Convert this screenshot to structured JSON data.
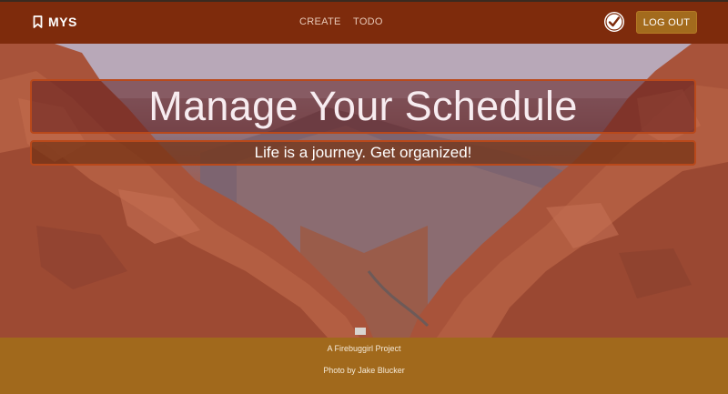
{
  "navbar": {
    "brand": "MYS",
    "brand_icon": "bookmark-icon",
    "links": [
      {
        "label": "CREATE"
      },
      {
        "label": "TODO"
      }
    ],
    "status_icon": "checkmark-circle-icon",
    "logout_label": "LOG OUT",
    "background_color": "#7e2b0c",
    "button_color": "#a36b1d"
  },
  "hero": {
    "title": "Manage Your Schedule",
    "subtitle": "Life is a journey. Get organized!",
    "background": "red rock canyon photo"
  },
  "footer": {
    "project_credit": "A Firebuggirl Project",
    "photo_credit": "Photo by Jake Blucker",
    "background_color": "#a1691c"
  }
}
